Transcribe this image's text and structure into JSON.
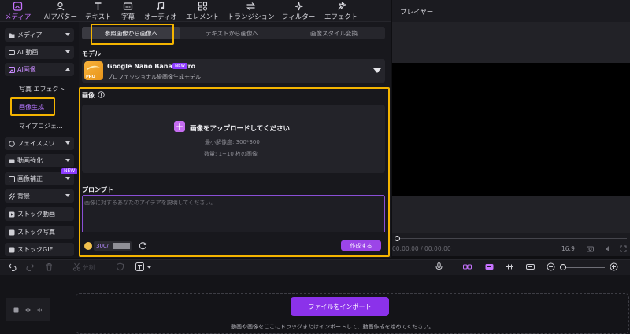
{
  "toolbar": {
    "items": [
      {
        "label": "メディア",
        "icon": "media-icon"
      },
      {
        "label": "AIアバター",
        "icon": "avatar-icon"
      },
      {
        "label": "テキスト",
        "icon": "text-icon"
      },
      {
        "label": "字幕",
        "icon": "subtitle-icon"
      },
      {
        "label": "オーディオ",
        "icon": "audio-icon"
      },
      {
        "label": "エレメント",
        "icon": "element-icon"
      },
      {
        "label": "トランジション",
        "icon": "transition-icon"
      },
      {
        "label": "フィルター",
        "icon": "filter-icon"
      },
      {
        "label": "エフェクト",
        "icon": "effect-icon"
      }
    ],
    "active_color": "#c773ff"
  },
  "player": {
    "title": "プレイヤー",
    "time": "00:00:00 / 00:00:00",
    "aspect": "16:9"
  },
  "sidebar": {
    "items": [
      {
        "label": "メディア"
      },
      {
        "label": "AI 動画"
      },
      {
        "label": "AI画像"
      },
      {
        "label": "写真 エフェクト"
      },
      {
        "label": "画像生成"
      },
      {
        "label": "マイプロジェ..."
      },
      {
        "label": "フェイススワ..."
      },
      {
        "label": "動画強化"
      },
      {
        "label": "画像補正"
      },
      {
        "label": "背景"
      },
      {
        "label": "ストック動画"
      },
      {
        "label": "ストック写真"
      },
      {
        "label": "ストックGIF"
      }
    ],
    "new_badge": "NEW"
  },
  "main": {
    "tabs": [
      {
        "label": "参照画像から画像へ"
      },
      {
        "label": "テキストから画像へ"
      },
      {
        "label": "画像スタイル変換"
      }
    ],
    "model_label": "モデル",
    "model": {
      "name": "Google Nano Banana Pro",
      "badge": "NEW",
      "logo_text": "PRO",
      "description": "プロフェッショナル級画像生成モデル"
    },
    "image_label": "画像",
    "upload": {
      "title": "画像をアップロードしてください",
      "plus": "+",
      "min_resolution": "最小解像度: 300*300",
      "quantity": "数量: 1~10 枚の画像"
    },
    "prompt_label": "プロンプト",
    "prompt_placeholder": "画像に対するあなたのアイデアを説明してください。",
    "credits": "300/",
    "create_label": "作成する"
  },
  "timeline": {
    "split_label": "分割",
    "import_label": "ファイルをインポート",
    "drop_hint": "動画や画像をここにドラッグまたはインポートして、動画作成を始めてください。"
  },
  "colors": {
    "accent": "#9c45e8",
    "highlight": "#f4b400",
    "background": "#0f0f12"
  }
}
